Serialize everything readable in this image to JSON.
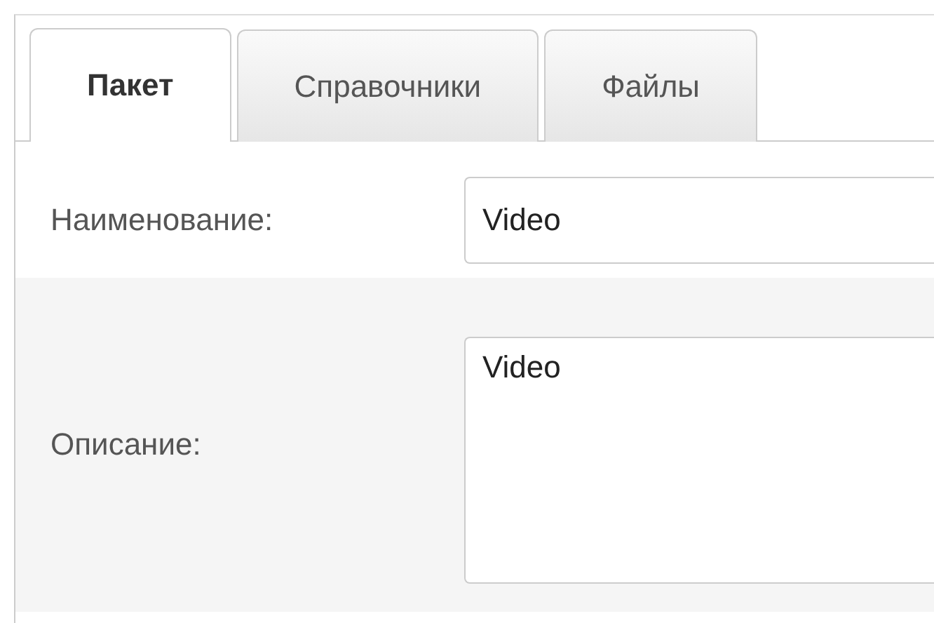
{
  "tabs": [
    {
      "label": "Пакет",
      "selected": true
    },
    {
      "label": "Справочники",
      "selected": false
    },
    {
      "label": "Файлы",
      "selected": false
    }
  ],
  "fields": [
    {
      "kind": "input",
      "label": "Наименование:",
      "value": "Video"
    },
    {
      "kind": "textarea",
      "label": "Описание:",
      "value": "Video"
    }
  ]
}
